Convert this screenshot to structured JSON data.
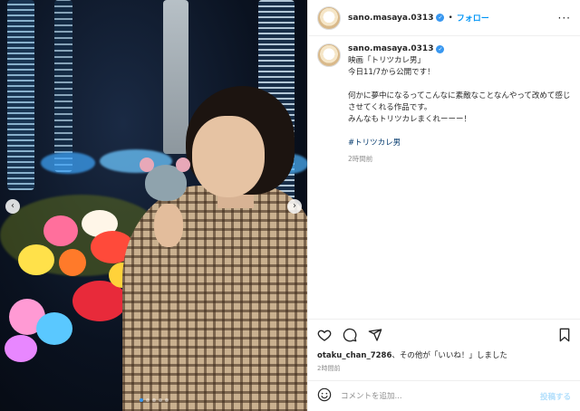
{
  "post": {
    "username": "sano.masaya.0313",
    "follow_label": "フォロー",
    "separator": "•",
    "caption_title": "映画「トリツカレ男」",
    "caption_lines": [
      "今日11/7から公開です！",
      "何かに夢中になるってこんなに素敵なことなんやって改めて感じさせてくれる作品です。",
      "みんなもトリツカレまくれーーー！"
    ],
    "hashtag": "#トリツカレ男",
    "caption_time": "2時間前",
    "likes_user": "otaku_chan_7286",
    "likes_suffix": "、その他が「いいね！」しました",
    "post_time": "2時間前",
    "comment_placeholder": "コメントを追加...",
    "post_button": "投稿する"
  },
  "carousel": {
    "total_slides": 5,
    "active_index": 0
  },
  "colors": {
    "accent": "#0095f6",
    "verified": "#3897f0",
    "text": "#262626",
    "muted": "#8e8e8e"
  },
  "icons": [
    "heart-icon",
    "comment-icon",
    "share-icon",
    "bookmark-icon",
    "emoji-icon",
    "more-icon",
    "verified-icon",
    "chevron-left-icon",
    "chevron-right-icon"
  ]
}
